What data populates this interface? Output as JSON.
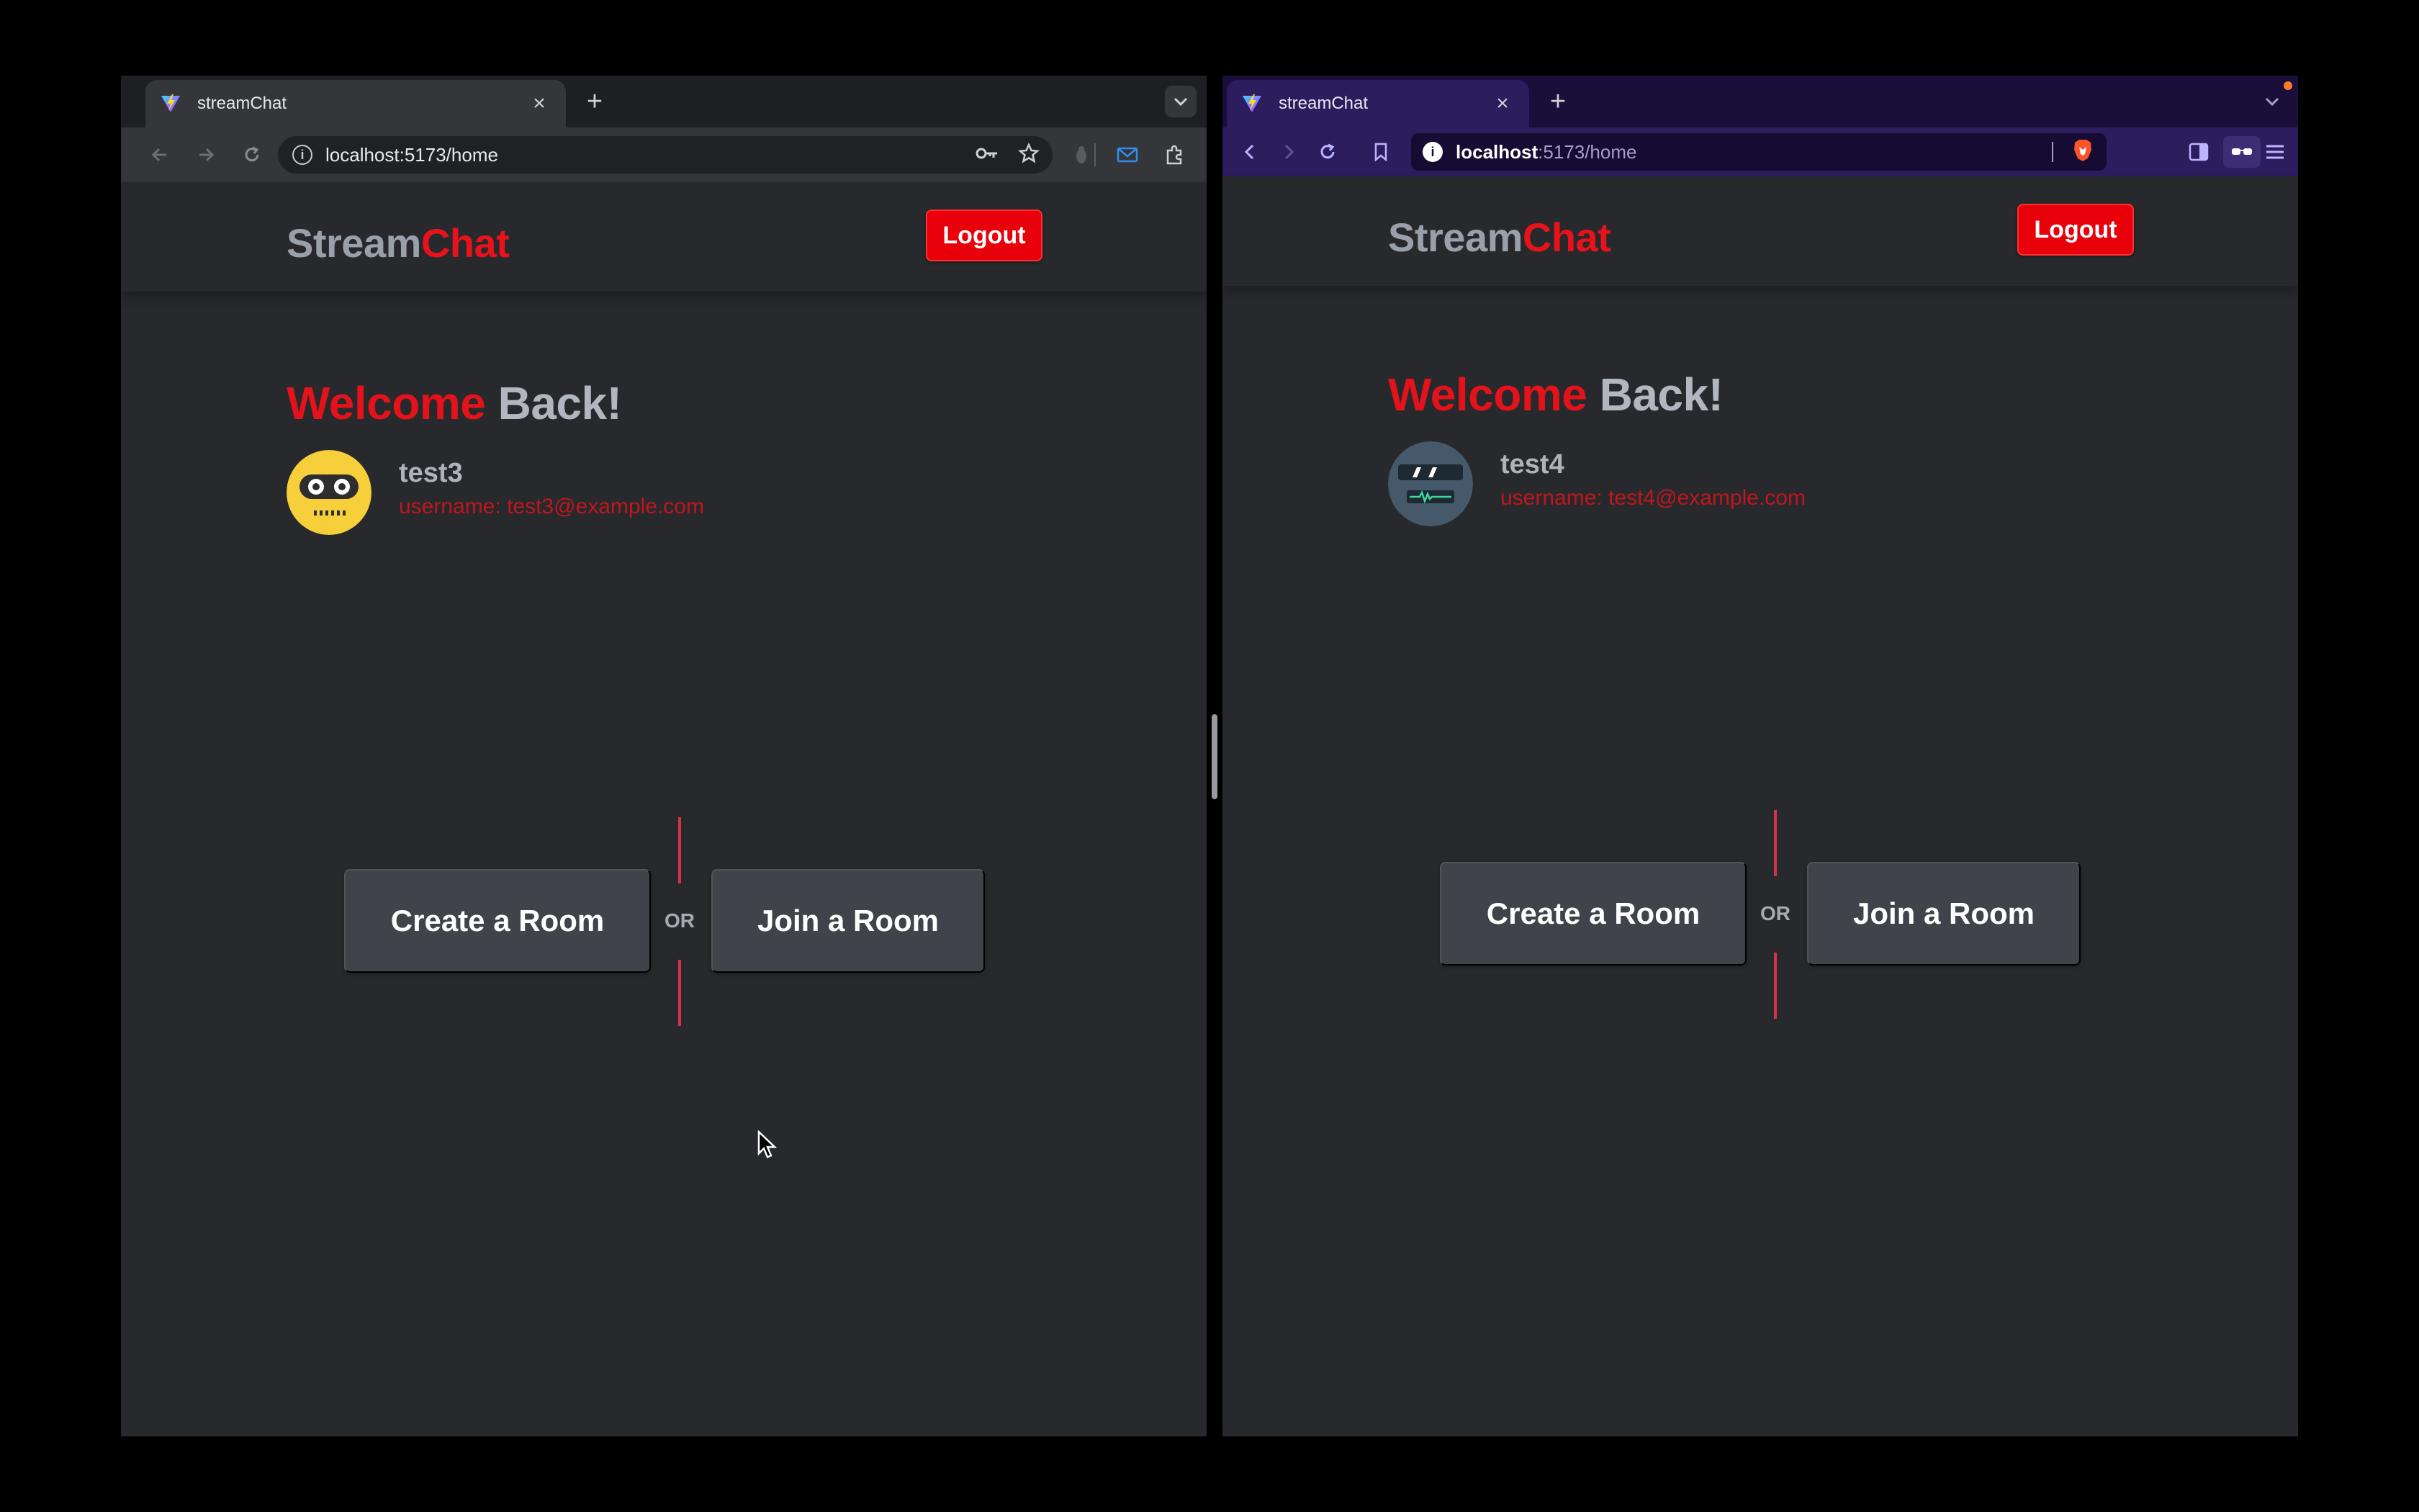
{
  "left_window": {
    "tab_title": "streamChat",
    "url": "localhost:5173/home",
    "app": {
      "logo_part1": "Stream",
      "logo_part2": "Chat",
      "logout_label": "Logout",
      "welcome_part1": "Welcome",
      "welcome_part2": "Back!",
      "user_name": "test3",
      "user_email": "username: test3@example.com",
      "create_label": "Create a Room",
      "or_label": "OR",
      "join_label": "Join a Room"
    }
  },
  "right_window": {
    "tab_title": "streamChat",
    "url_host": "localhost",
    "url_path": ":5173/home",
    "app": {
      "logo_part1": "Stream",
      "logo_part2": "Chat",
      "logout_label": "Logout",
      "welcome_part1": "Welcome",
      "welcome_part2": "Back!",
      "user_name": "test4",
      "user_email": "username: test4@example.com",
      "create_label": "Create a Room",
      "or_label": "OR",
      "join_label": "Join a Room"
    }
  },
  "icons": {
    "tab_favicon": "vite-logo-icon",
    "close": "close-icon",
    "new_tab": "plus-icon",
    "tab_search": "chevron-down-icon",
    "back": "back-arrow-icon",
    "forward": "forward-arrow-icon",
    "reload": "reload-icon",
    "site_info": "info-icon",
    "password": "key-icon",
    "bookmark": "star-icon",
    "brave_shield": "brave-lion-icon"
  },
  "colors": {
    "accent_red": "#e8000b",
    "app_background": "#28292d",
    "button_background": "#40434a",
    "chrome_toolbar": "#35363a",
    "brave_toolbar": "#2c1d5e"
  }
}
